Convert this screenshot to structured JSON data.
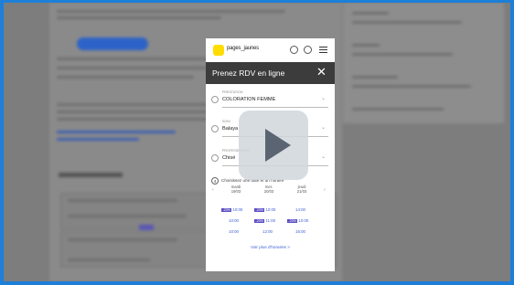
{
  "modal": {
    "logo_text": "pages_jaunes",
    "title": "Prenez RDV en ligne",
    "close_symbol": "✕",
    "fields": [
      {
        "label": "prestation",
        "value": "COLORATION FEMME"
      },
      {
        "label": "soin",
        "value": "Balaya"
      },
      {
        "label": "professionnel",
        "value": "Chisé"
      }
    ],
    "step4": {
      "number": "4",
      "text": "Choisissez une date et un horaire"
    },
    "days": [
      {
        "name": "mardi",
        "date": "19/03"
      },
      {
        "name": "mer.",
        "date": "20/03"
      },
      {
        "name": "jeudi",
        "date": "21/03"
      }
    ],
    "slots": [
      [
        "10:00",
        "10:00",
        "14:00"
      ],
      [
        "10:00",
        "11:00",
        "10:00"
      ],
      [
        "10:00",
        "12:00",
        "16:00"
      ]
    ],
    "badge": "-20%",
    "more_label": "Voir plus d'horaires >"
  },
  "icons": {
    "play": "play-icon",
    "close": "close-icon",
    "menu": "menu-icon",
    "logo": "pagesjaunes-logo-icon"
  },
  "colors": {
    "frame_border": "#1e7fd8",
    "header": "#3c3c3c",
    "logo_yellow": "#ffdd00",
    "link": "#3e5fd6",
    "badge": "#5b4fc4"
  }
}
